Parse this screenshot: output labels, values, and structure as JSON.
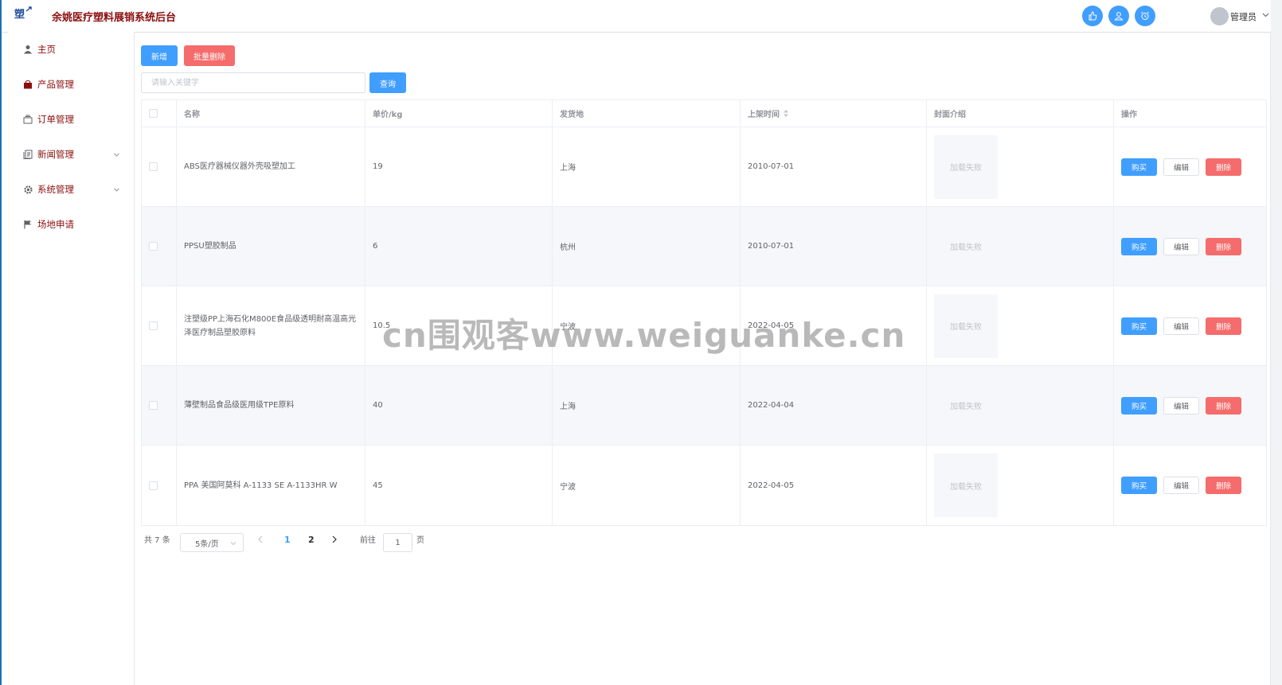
{
  "header": {
    "title": "余姚医疗塑料展销系统后台",
    "user": "管理员",
    "accent": "#409eff",
    "title_color": "#8b0e0e"
  },
  "sidebar": {
    "items": [
      {
        "label": "主页",
        "icon": "user-icon"
      },
      {
        "label": "产品管理",
        "icon": "bag-icon"
      },
      {
        "label": "订单管理",
        "icon": "tray-icon"
      },
      {
        "label": "新闻管理",
        "icon": "document-icon",
        "expandable": true
      },
      {
        "label": "系统管理",
        "icon": "gear-icon",
        "expandable": true
      },
      {
        "label": "场地申请",
        "icon": "flag-icon"
      }
    ]
  },
  "toolbar": {
    "add_label": "新增",
    "batch_delete_label": "批量删除",
    "search_placeholder": "请输入关键字",
    "search_value": "",
    "query_label": "查询"
  },
  "table": {
    "columns": [
      "名称",
      "单价/kg",
      "发货地",
      "上架时间",
      "封面介绍",
      "操作"
    ],
    "rows": [
      {
        "name": "ABS医疗器械仪器外壳吸塑加工",
        "price": "19",
        "origin": "上海",
        "date": "2010-07-01",
        "cover": "加载失败"
      },
      {
        "name": "PPSU塑胶制品",
        "price": "6",
        "origin": "杭州",
        "date": "2010-07-01",
        "cover": "加载失败"
      },
      {
        "name": "注塑级PP上海石化M800E食品级透明耐高温高光泽医疗制品塑胶原料",
        "price": "10.5",
        "origin": "宁波",
        "date": "2022-04-05",
        "cover": "加载失败"
      },
      {
        "name": "薄壁制品食品级医用级TPE原料",
        "price": "40",
        "origin": "上海",
        "date": "2022-04-04",
        "cover": "加载失败"
      },
      {
        "name": "PPA 美国阿莫科 A-1133 SE A-1133HR W",
        "price": "45",
        "origin": "宁波",
        "date": "2022-04-05",
        "cover": "加载失败"
      }
    ],
    "actions": {
      "buy": "购买",
      "edit": "编辑",
      "delete": "删除"
    }
  },
  "pagination": {
    "total_text": "共 7 条",
    "page_size": "5条/页",
    "pages": [
      "1",
      "2"
    ],
    "current_page": "1",
    "goto_label": "前往",
    "goto_value": "1",
    "page_suffix": "页"
  },
  "watermark": "cn围观客www.weiguanke.cn"
}
